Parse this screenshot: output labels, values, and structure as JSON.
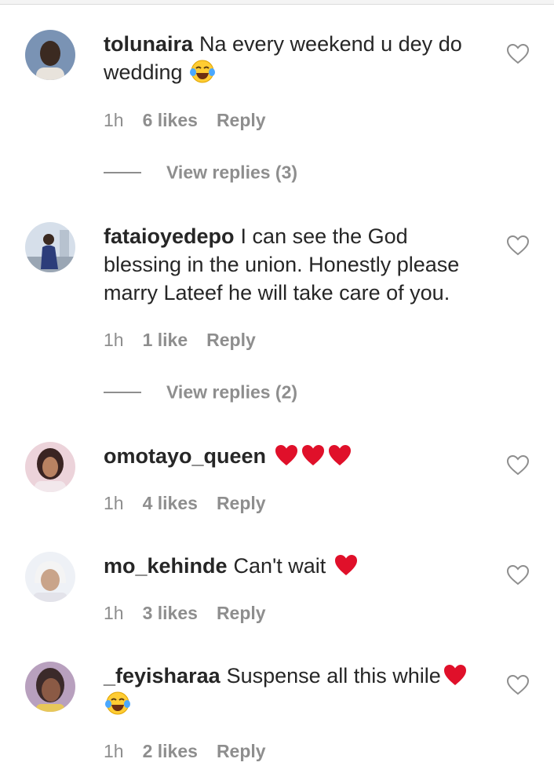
{
  "comments": [
    {
      "username": "tolunaira",
      "text": "Na every weekend u dey do wedding",
      "time": "1h",
      "likes": "6 likes",
      "reply": "Reply",
      "view_replies": "View replies (3)",
      "avatar_colors": [
        "#6d86a8",
        "#3b2a21"
      ]
    },
    {
      "username": "fataioyedepo",
      "text": "I can see the God blessing in the union. Honestly please marry Lateef he will take care of you.",
      "time": "1h",
      "likes": "1 like",
      "reply": "Reply",
      "view_replies": "View replies (2)",
      "avatar_colors": [
        "#cfd9e6",
        "#2c3d7a"
      ]
    },
    {
      "username": "omotayo_queen",
      "text": "",
      "time": "1h",
      "likes": "4 likes",
      "reply": "Reply",
      "avatar_colors": [
        "#e9cfd7",
        "#3a2422"
      ]
    },
    {
      "username": "mo_kehinde",
      "text": "Can't wait",
      "time": "1h",
      "likes": "3 likes",
      "reply": "Reply",
      "avatar_colors": [
        "#eaeef5",
        "#c9a48a"
      ]
    },
    {
      "username": "_feyisharaa",
      "text": "Suspense all this while",
      "time": "1h",
      "likes": "2 likes",
      "reply": "Reply",
      "avatar_colors": [
        "#b39ab8",
        "#3b2a2a"
      ]
    }
  ],
  "icons": {
    "like": "heart-outline-icon",
    "laugh": "face-with-tears-of-joy-icon",
    "love": "red-heart-icon"
  },
  "colors": {
    "text": "#262626",
    "secondary": "#8e8e8e",
    "heart_red": "#e0102a"
  }
}
